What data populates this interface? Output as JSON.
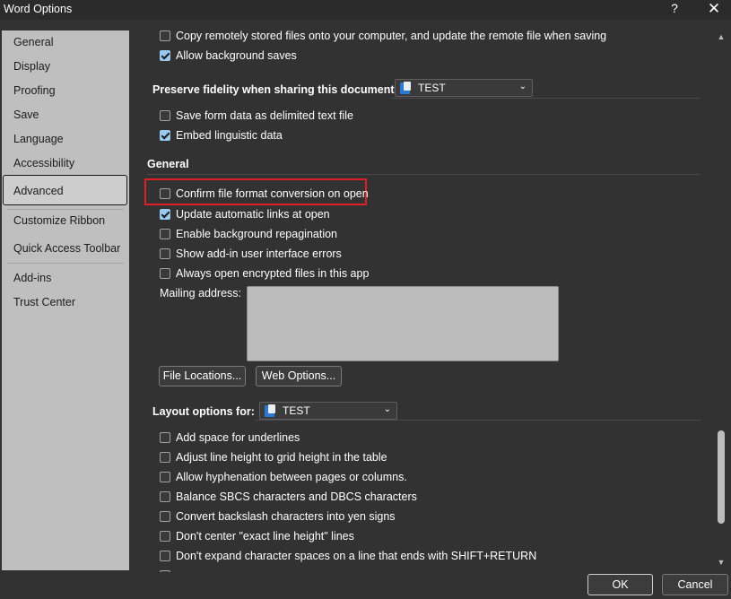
{
  "window": {
    "title": "Word Options",
    "help_glyph": "?",
    "close_glyph": "✕"
  },
  "sidebar": {
    "items": [
      {
        "label": "General"
      },
      {
        "label": "Display"
      },
      {
        "label": "Proofing"
      },
      {
        "label": "Save"
      },
      {
        "label": "Language"
      },
      {
        "label": "Accessibility"
      },
      {
        "label": "Advanced",
        "selected": true
      },
      {
        "label": "Customize Ribbon"
      },
      {
        "label": "Quick Access Toolbar"
      },
      {
        "label": "Add-ins"
      },
      {
        "label": "Trust Center"
      }
    ]
  },
  "save_section": {
    "copy_remote": {
      "label": "Copy remotely stored files onto your computer, and update the remote file when saving",
      "checked": false
    },
    "background_saves": {
      "label": "Allow background saves",
      "checked": true
    }
  },
  "fidelity": {
    "heading": "Preserve fidelity when sharing this document:",
    "document": "TEST",
    "form_data": {
      "label": "Save form data as delimited text file",
      "checked": false
    },
    "linguistic": {
      "label": "Embed linguistic data",
      "checked": true
    }
  },
  "general": {
    "heading": "General",
    "confirm_conversion": {
      "label": "Confirm file format conversion on open",
      "checked": false
    },
    "update_links": {
      "label": "Update automatic links at open",
      "checked": true
    },
    "background_repag": {
      "label": "Enable background repagination",
      "checked": false
    },
    "addin_errors": {
      "label": "Show add-in user interface errors",
      "checked": false
    },
    "encrypted_files": {
      "label": "Always open encrypted files in this app",
      "checked": false
    },
    "mailing_label": "Mailing address:",
    "mailing_value": "",
    "file_locations": "File Locations...",
    "web_options": "Web Options..."
  },
  "layout": {
    "heading": "Layout options for:",
    "document": "TEST",
    "options": [
      {
        "label": "Add space for underlines",
        "checked": false
      },
      {
        "label": "Adjust line height to grid height in the table",
        "checked": false
      },
      {
        "label": "Allow hyphenation between pages or columns.",
        "checked": false
      },
      {
        "label": "Balance SBCS characters and DBCS characters",
        "checked": false
      },
      {
        "label": "Convert backslash characters into yen signs",
        "checked": false
      },
      {
        "label": "Don't center \"exact line height\" lines",
        "checked": false
      },
      {
        "label": "Don't expand character spaces on a line that ends with SHIFT+RETURN",
        "checked": false
      }
    ]
  },
  "footer": {
    "ok": "OK",
    "cancel": "Cancel"
  }
}
